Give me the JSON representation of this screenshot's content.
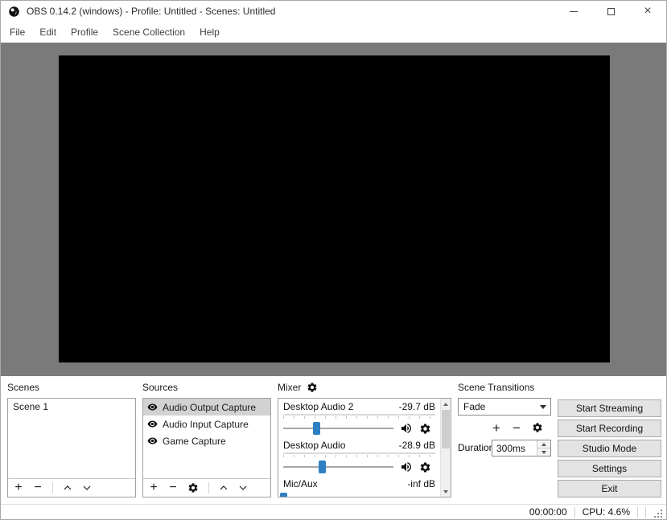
{
  "window": {
    "title": "OBS 0.14.2 (windows) - Profile: Untitled - Scenes: Untitled"
  },
  "icons": {
    "plus": "+",
    "minus": "−",
    "close": "×"
  },
  "menu": {
    "items": [
      "File",
      "Edit",
      "Profile",
      "Scene Collection",
      "Help"
    ]
  },
  "scenes": {
    "label": "Scenes",
    "items": [
      "Scene 1"
    ]
  },
  "sources": {
    "label": "Sources",
    "items": [
      {
        "label": "Audio Output Capture",
        "selected": true
      },
      {
        "label": "Audio Input Capture",
        "selected": false
      },
      {
        "label": "Game Capture",
        "selected": false
      }
    ]
  },
  "mixer": {
    "label": "Mixer",
    "channels": [
      {
        "name": "Desktop Audio 2",
        "level": "-29.7 dB",
        "slider_pct": 30
      },
      {
        "name": "Desktop Audio",
        "level": "-28.9 dB",
        "slider_pct": 35
      },
      {
        "name": "Mic/Aux",
        "level": "-inf dB",
        "slider_pct": 0
      }
    ]
  },
  "transitions": {
    "label": "Scene Transitions",
    "selected": "Fade",
    "duration_label": "Duration",
    "duration_value": "300ms"
  },
  "controls": {
    "buttons": [
      "Start Streaming",
      "Start Recording",
      "Studio Mode",
      "Settings",
      "Exit"
    ]
  },
  "statusbar": {
    "time": "00:00:00",
    "cpu": "CPU: 4.6%"
  },
  "colors": {
    "accent": "#2f80c3",
    "preview_bg": "#7a7a7a",
    "selection": "#d2d2d2"
  }
}
